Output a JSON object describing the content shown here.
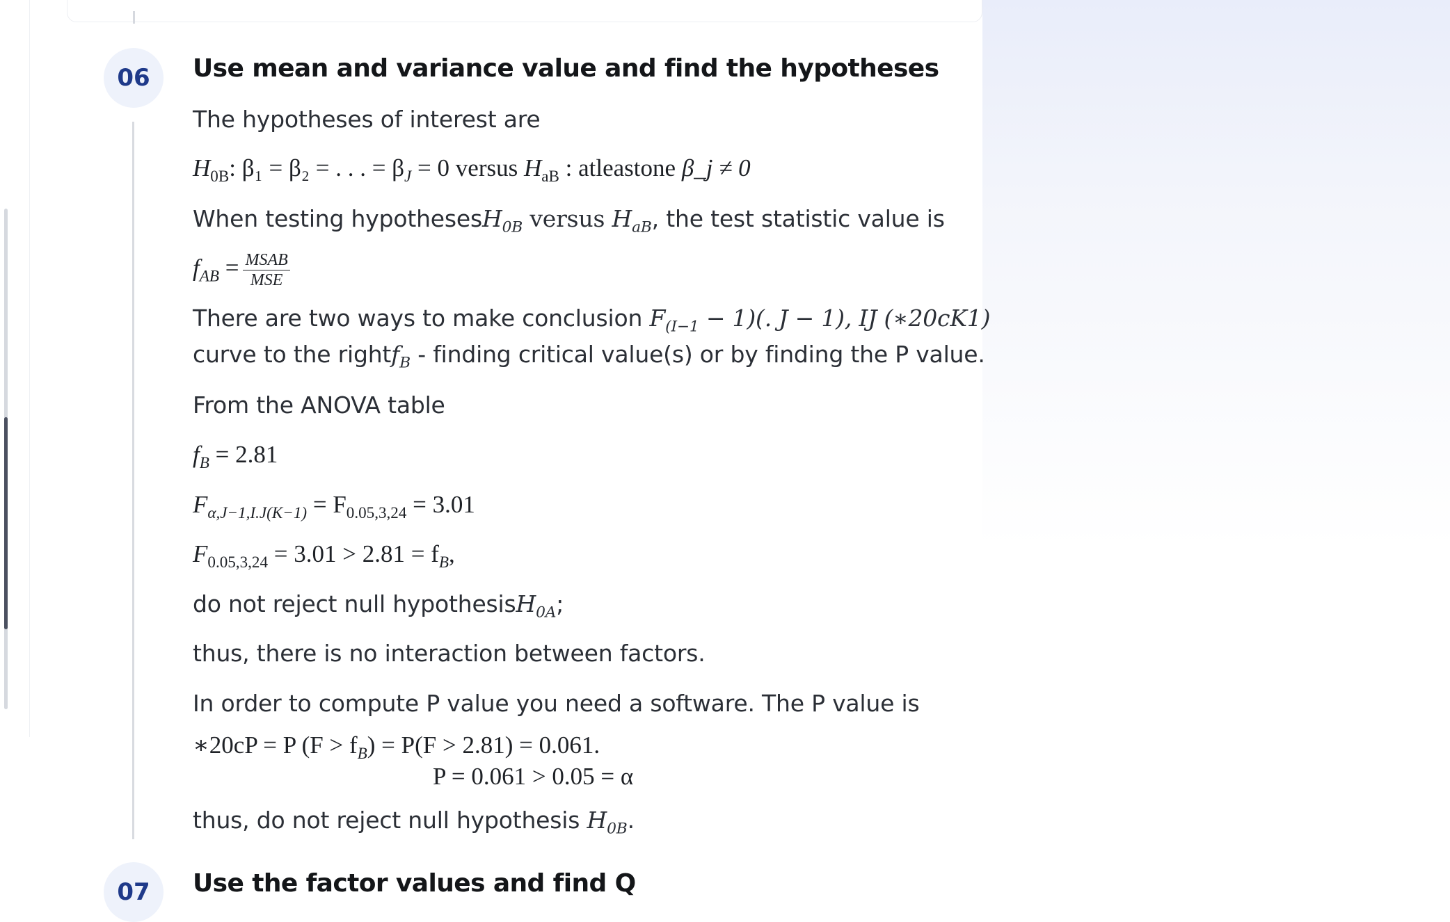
{
  "step": {
    "number": "06",
    "title": "Use mean and variance value and find the hypotheses"
  },
  "next_step": {
    "number": "07",
    "title": "Use the factor values and find Q"
  },
  "lines": {
    "intro": "The hypotheses of interest are",
    "hyp_h": "H",
    "hyp_sub": "0B",
    "hyp_rest": ": β₁ = β₂ = . . . = β",
    "hyp_j": "J",
    "hyp_eq0": " = 0",
    "hyp_versus": " versus ",
    "hyp_ha": "H",
    "hyp_ha_sub": "aB",
    "hyp_tail": " :  atleastone ",
    "hyp_beta": "β_j ≠ 0",
    "testing_pre": "When testing hypotheses",
    "testing_h0": "H",
    "testing_h0_sub": "0B",
    "testing_versus": " versus ",
    "testing_ha": "H",
    "testing_ha_sub": "aB",
    "testing_post": ", the test statistic value is",
    "f_lhs": "f",
    "f_lhs_sub": "AB",
    "f_eq": " =",
    "frac_num": "MSAB",
    "frac_den": "MSE",
    "ways_pre": "There are two ways to make conclusion ",
    "ways_F": "F",
    "ways_Fsub": "(I−1",
    "ways_math": " − 1)(. J − 1), IJ (∗20cK1)",
    "curve_pre": "curve to the right",
    "curve_f": "f",
    "curve_fsub": "B",
    "curve_post": " - finding critical value(s) or by finding the P value.",
    "anova": "From the ANOVA table",
    "fb_f": "f",
    "fb_sub": "B",
    "fb_val": " = 2.81",
    "crit_F": "F",
    "crit_sub": "α,J−1,I.J(K−1)",
    "crit_mid": " = F",
    "crit_sub2": "0.05,3,24",
    "crit_val": " = 3.01",
    "cmp_F": "F",
    "cmp_sub": "0.05,3,24",
    "cmp_mid": " = 3.01 > 2.81 = f",
    "cmp_sub2": "B",
    "cmp_end": ",",
    "reject_pre": "do not reject null hypothesis",
    "reject_h": "H",
    "reject_sub": "0A",
    "reject_end": ";",
    "interaction": "thus, there is no interaction between factors.",
    "software": "In order to compute P value you need a software. The P value is",
    "p_line1": "∗20cP = P (F > f",
    "p_line1_sub": "B",
    "p_line1_end": ") = P(F > 2.81) = 0.061.",
    "p_line2": "P = 0.061 > 0.05 = α",
    "final_pre": "thus, do not reject null hypothesis ",
    "final_h": "H",
    "final_sub": "0B",
    "final_end": "."
  },
  "colors": {
    "accent": "#1f3a8a",
    "badge_bg": "#eef2fb",
    "title": "#141619",
    "text": "#2b2f36"
  }
}
